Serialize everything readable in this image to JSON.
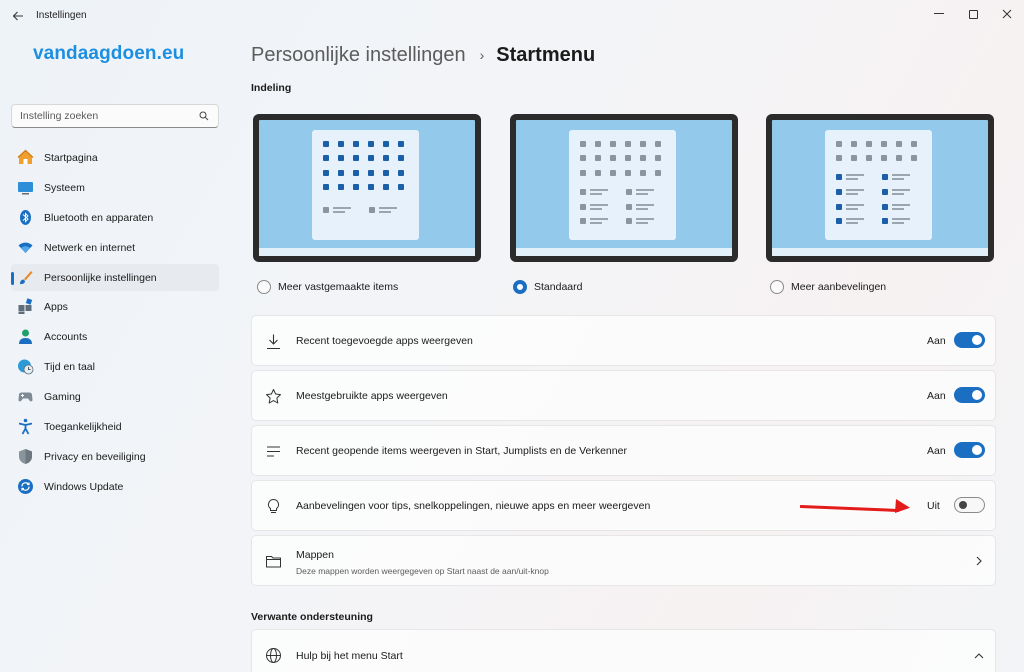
{
  "window": {
    "title": "Instellingen"
  },
  "brand": "vandaagdoen.eu",
  "search": {
    "placeholder": "Instelling zoeken"
  },
  "sidebar": {
    "items": [
      {
        "label": "Startpagina",
        "icon": "home-icon"
      },
      {
        "label": "Systeem",
        "icon": "monitor-icon"
      },
      {
        "label": "Bluetooth en apparaten",
        "icon": "bluetooth-icon"
      },
      {
        "label": "Netwerk en internet",
        "icon": "wifi-icon"
      },
      {
        "label": "Persoonlijke instellingen",
        "icon": "brush-icon",
        "active": true
      },
      {
        "label": "Apps",
        "icon": "apps-icon"
      },
      {
        "label": "Accounts",
        "icon": "person-icon"
      },
      {
        "label": "Tijd en taal",
        "icon": "globe-clock-icon"
      },
      {
        "label": "Gaming",
        "icon": "gamepad-icon"
      },
      {
        "label": "Toegankelijkheid",
        "icon": "accessibility-icon"
      },
      {
        "label": "Privacy en beveiliging",
        "icon": "shield-icon"
      },
      {
        "label": "Windows Update",
        "icon": "update-icon"
      }
    ]
  },
  "header": {
    "parent": "Persoonlijke instellingen",
    "separator": "›",
    "current": "Startmenu"
  },
  "layout": {
    "section_title": "Indeling",
    "options": [
      {
        "label": "Meer vastgemaakte items",
        "selected": false
      },
      {
        "label": "Standaard",
        "selected": true
      },
      {
        "label": "Meer aanbevelingen",
        "selected": false
      }
    ]
  },
  "settings": [
    {
      "label": "Recent toegevoegde apps weergeven",
      "state": "Aan",
      "on": true,
      "icon": "download-icon"
    },
    {
      "label": "Meestgebruikte apps weergeven",
      "state": "Aan",
      "on": true,
      "icon": "star-icon"
    },
    {
      "label": "Recent geopende items weergeven in Start, Jumplists en de Verkenner",
      "state": "Aan",
      "on": true,
      "icon": "list-icon"
    },
    {
      "label": "Aanbevelingen voor tips, snelkoppelingen, nieuwe apps en meer weergeven",
      "state": "Uit",
      "on": false,
      "icon": "lightbulb-icon"
    }
  ],
  "folders": {
    "label": "Mappen",
    "sub": "Deze mappen worden weergegeven op Start naast de aan/uit-knop"
  },
  "related": {
    "section_title": "Verwante ondersteuning",
    "help_label": "Hulp bij het menu Start"
  },
  "colors": {
    "accent": "#1a6fc2",
    "brand": "#1d8fe0",
    "annotation_arrow": "#e31b1b"
  }
}
